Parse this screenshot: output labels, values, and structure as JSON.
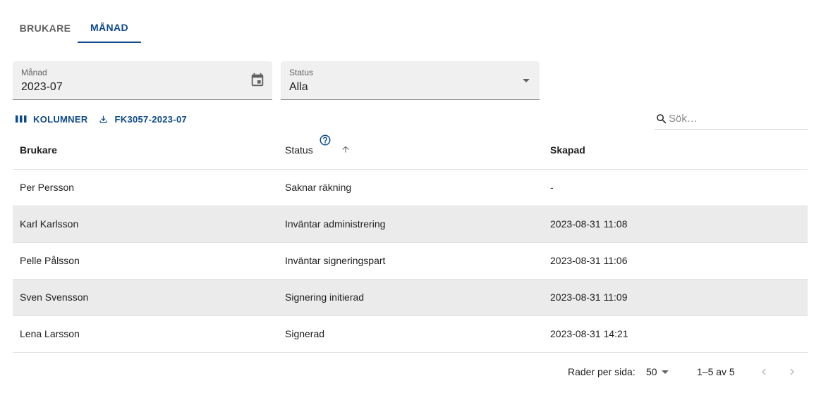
{
  "tabs": [
    {
      "label": "BRUKARE",
      "active": false
    },
    {
      "label": "MÅNAD",
      "active": true
    }
  ],
  "filters": {
    "manad": {
      "label": "Månad",
      "value": "2023-07",
      "icon": "calendar-icon"
    },
    "status": {
      "label": "Status",
      "value": "Alla",
      "icon": "dropdown-arrow-icon"
    }
  },
  "toolbar": {
    "columns_label": "KOLUMNER",
    "export_label": "FK3057-2023-07"
  },
  "search": {
    "placeholder": "Sök…"
  },
  "table": {
    "headers": [
      "Brukare",
      "Status",
      "Skapad"
    ],
    "rows": [
      [
        "Per Persson",
        "Saknar räkning",
        "-"
      ],
      [
        "Karl Karlsson",
        "Inväntar administrering",
        "2023-08-31 11:08"
      ],
      [
        "Pelle Pålsson",
        "Inväntar signeringspart",
        "2023-08-31 11:06"
      ],
      [
        "Sven Svensson",
        "Signering initierad",
        "2023-08-31 11:09"
      ],
      [
        "Lena Larsson",
        "Signerad",
        "2023-08-31 14:21"
      ]
    ]
  },
  "pagination": {
    "rows_per_page_label": "Rader per sida:",
    "rows_per_page_value": "50",
    "range_label": "1–5 av 5"
  },
  "colors": {
    "accent": "#0d4a8c",
    "alt_row": "#ebebeb",
    "field_bg": "#f0f0f0"
  }
}
